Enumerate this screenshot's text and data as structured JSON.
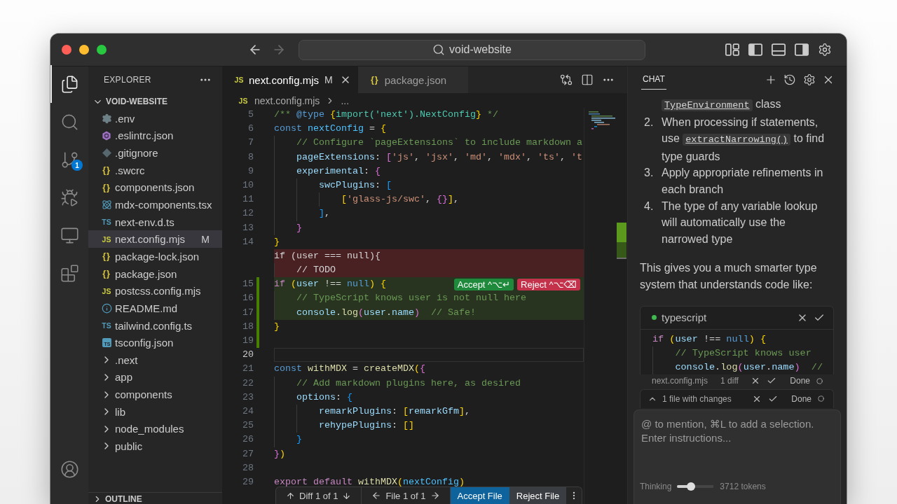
{
  "window": {
    "traffic_lights": [
      {
        "color": "#ff5f57"
      },
      {
        "color": "#febc2e"
      },
      {
        "color": "#28c840"
      }
    ]
  },
  "title_bar": {
    "nav": [
      {
        "kind": "back",
        "disabled": false
      },
      {
        "kind": "forward",
        "disabled": true
      }
    ],
    "command_center": "void-website",
    "layout_toggles": [
      {
        "kind": "primary-sidebar",
        "on": true
      },
      {
        "kind": "panel",
        "on": false
      },
      {
        "kind": "secondary-sidebar",
        "on": true
      }
    ]
  },
  "activity_bar": {
    "items": [
      {
        "kind": "explorer",
        "selected": true
      },
      {
        "kind": "search",
        "selected": false
      },
      {
        "kind": "source-control",
        "selected": false,
        "badge": "1"
      },
      {
        "kind": "run-debug",
        "selected": false
      },
      {
        "kind": "remote",
        "selected": false
      },
      {
        "kind": "extensions",
        "selected": false
      }
    ],
    "bottom": [
      {
        "kind": "accounts"
      }
    ]
  },
  "sidebar": {
    "title": "EXPLORER",
    "folder": {
      "name": "VOID-WEBSITE",
      "expanded": true,
      "children": [
        {
          "name": ".env",
          "kind": "env",
          "selected": false
        },
        {
          "name": ".eslintrc.json",
          "kind": "eslint",
          "selected": false
        },
        {
          "name": ".gitignore",
          "kind": "git",
          "selected": false
        },
        {
          "name": ".swcrc",
          "kind": "json",
          "badge": "{}",
          "selected": false
        },
        {
          "name": "components.json",
          "kind": "json",
          "badge": "{}",
          "selected": false
        },
        {
          "name": "mdx-components.tsx",
          "kind": "react",
          "selected": false
        },
        {
          "name": "next-env.d.ts",
          "kind": "ts",
          "badge": "TS",
          "selected": false
        },
        {
          "name": "next.config.mjs",
          "kind": "js",
          "badge": "JS",
          "status": "M",
          "selected": true
        },
        {
          "name": "package-lock.json",
          "kind": "json",
          "badge": "{}",
          "selected": false
        },
        {
          "name": "package.json",
          "kind": "json",
          "badge": "{}",
          "selected": false
        },
        {
          "name": "postcss.config.mjs",
          "kind": "js",
          "badge": "JS",
          "selected": false
        },
        {
          "name": "README.md",
          "kind": "info",
          "selected": false
        },
        {
          "name": "tailwind.config.ts",
          "kind": "ts",
          "badge": "TS",
          "selected": false
        },
        {
          "name": "tsconfig.json",
          "kind": "tsconfig",
          "badge": "TS",
          "selected": false
        },
        {
          "name": ".next",
          "kind": "folder",
          "expanded": false,
          "selected": false
        },
        {
          "name": "app",
          "kind": "folder",
          "expanded": false,
          "selected": false
        },
        {
          "name": "components",
          "kind": "folder",
          "expanded": false,
          "selected": false
        },
        {
          "name": "lib",
          "kind": "folder",
          "expanded": false,
          "selected": false
        },
        {
          "name": "node_modules",
          "kind": "folder",
          "expanded": false,
          "selected": false
        },
        {
          "name": "public",
          "kind": "folder",
          "expanded": false,
          "selected": false
        }
      ]
    },
    "outline": {
      "title": "OUTLINE",
      "expanded": false
    }
  },
  "editor": {
    "tabs": [
      {
        "name": "next.config.mjs",
        "kind": "js",
        "badge": "JS",
        "status": "M",
        "selected": true
      },
      {
        "name": "package.json",
        "kind": "json",
        "badge": "{}",
        "selected": false
      }
    ],
    "breadcrumb": {
      "kind": "js",
      "badge": "JS",
      "file": "next.config.mjs",
      "more": "..."
    },
    "lines": [
      {
        "number": "5",
        "kind": "normal",
        "current": false,
        "tokens": [
          {
            "text": "/** ",
            "kind": "comment"
          },
          {
            "text": "@type ",
            "kind": "doc-tag"
          },
          {
            "text": "{",
            "kind": "bracket1"
          },
          {
            "text": "import('next').NextConfig",
            "kind": "type"
          },
          {
            "text": "}",
            "kind": "bracket1"
          },
          {
            "text": " */",
            "kind": "comment"
          }
        ]
      },
      {
        "number": "6",
        "kind": "normal",
        "current": false,
        "tokens": [
          {
            "text": "const ",
            "kind": "keyword"
          },
          {
            "text": "nextConfig",
            "kind": "variable"
          },
          {
            "text": " = ",
            "kind": "plain"
          },
          {
            "text": "{",
            "kind": "bracket1"
          }
        ]
      },
      {
        "number": "7",
        "kind": "normal",
        "current": false,
        "tokens": [
          {
            "text": "    // Configure `pageExtensions` to include markdown a",
            "kind": "comment"
          }
        ]
      },
      {
        "number": "8",
        "kind": "normal",
        "current": false,
        "tokens": [
          {
            "text": "    pageExtensions",
            "kind": "property"
          },
          {
            "text": ": ",
            "kind": "plain"
          },
          {
            "text": "[",
            "kind": "bracket2"
          },
          {
            "text": "'js'",
            "kind": "string"
          },
          {
            "text": ", ",
            "kind": "plain"
          },
          {
            "text": "'jsx'",
            "kind": "string"
          },
          {
            "text": ", ",
            "kind": "plain"
          },
          {
            "text": "'md'",
            "kind": "string"
          },
          {
            "text": ", ",
            "kind": "plain"
          },
          {
            "text": "'mdx'",
            "kind": "string"
          },
          {
            "text": ", ",
            "kind": "plain"
          },
          {
            "text": "'ts'",
            "kind": "string"
          },
          {
            "text": ", ",
            "kind": "plain"
          },
          {
            "text": "'t",
            "kind": "string"
          }
        ]
      },
      {
        "number": "9",
        "kind": "normal",
        "current": false,
        "tokens": [
          {
            "text": "    experimental",
            "kind": "property"
          },
          {
            "text": ": ",
            "kind": "plain"
          },
          {
            "text": "{",
            "kind": "bracket2"
          }
        ]
      },
      {
        "number": "10",
        "kind": "normal",
        "current": false,
        "tokens": [
          {
            "text": "        swcPlugins",
            "kind": "property"
          },
          {
            "text": ": ",
            "kind": "plain"
          },
          {
            "text": "[",
            "kind": "bracket3"
          }
        ]
      },
      {
        "number": "11",
        "kind": "normal",
        "current": false,
        "tokens": [
          {
            "text": "            [",
            "kind": "bracket1"
          },
          {
            "text": "'glass-js/swc'",
            "kind": "string"
          },
          {
            "text": ", ",
            "kind": "plain"
          },
          {
            "text": "{}",
            "kind": "bracket2"
          },
          {
            "text": "]",
            "kind": "bracket1"
          },
          {
            "text": ",",
            "kind": "plain"
          }
        ]
      },
      {
        "number": "12",
        "kind": "normal",
        "current": false,
        "tokens": [
          {
            "text": "        ]",
            "kind": "bracket3"
          },
          {
            "text": ",",
            "kind": "plain"
          }
        ]
      },
      {
        "number": "13",
        "kind": "normal",
        "current": false,
        "tokens": [
          {
            "text": "    }",
            "kind": "bracket2"
          }
        ]
      },
      {
        "number": "14",
        "kind": "normal",
        "current": false,
        "tokens": [
          {
            "text": "}",
            "kind": "bracket1"
          }
        ]
      },
      {
        "kind": "deleted",
        "current": false,
        "tokens": [
          {
            "text": "if (user === null){",
            "kind": "plain"
          }
        ]
      },
      {
        "kind": "deleted",
        "current": false,
        "tokens": [
          {
            "text": "    // TODO",
            "kind": "plain"
          }
        ]
      },
      {
        "number": "15",
        "kind": "added",
        "current": false,
        "tokens": [
          {
            "text": "if ",
            "kind": "control"
          },
          {
            "text": "(",
            "kind": "bracket1"
          },
          {
            "text": "user",
            "kind": "property"
          },
          {
            "text": " !== ",
            "kind": "plain"
          },
          {
            "text": "null",
            "kind": "keyword"
          },
          {
            "text": ") {",
            "kind": "bracket1"
          }
        ],
        "actions": [
          {
            "kind": "accept",
            "label": "Accept ^⌥↵"
          },
          {
            "kind": "reject",
            "label": "Reject ^⌥⌫"
          }
        ]
      },
      {
        "number": "16",
        "kind": "added",
        "current": false,
        "tokens": [
          {
            "text": "    // TypeScript knows user is not null here",
            "kind": "comment"
          }
        ]
      },
      {
        "number": "17",
        "kind": "added",
        "current": false,
        "tokens": [
          {
            "text": "    console",
            "kind": "property"
          },
          {
            "text": ".",
            "kind": "plain"
          },
          {
            "text": "log",
            "kind": "function"
          },
          {
            "text": "(",
            "kind": "bracket2"
          },
          {
            "text": "user",
            "kind": "property"
          },
          {
            "text": ".",
            "kind": "plain"
          },
          {
            "text": "name",
            "kind": "property"
          },
          {
            "text": ")",
            "kind": "bracket2"
          },
          {
            "text": "  // Safe!",
            "kind": "comment"
          }
        ]
      },
      {
        "number": "18",
        "kind": "changed",
        "current": false,
        "tokens": [
          {
            "text": "}",
            "kind": "bracket1"
          }
        ]
      },
      {
        "number": "19",
        "kind": "changed",
        "current": false
      },
      {
        "number": "20",
        "kind": "normal",
        "current": true
      },
      {
        "number": "21",
        "kind": "normal",
        "current": false,
        "tokens": [
          {
            "text": "const ",
            "kind": "keyword"
          },
          {
            "text": "withMDX",
            "kind": "function"
          },
          {
            "text": " = ",
            "kind": "plain"
          },
          {
            "text": "createMDX",
            "kind": "function"
          },
          {
            "text": "(",
            "kind": "bracket1"
          },
          {
            "text": "{",
            "kind": "bracket2"
          }
        ]
      },
      {
        "number": "22",
        "kind": "normal",
        "current": false,
        "tokens": [
          {
            "text": "    // Add markdown plugins here, as desired",
            "kind": "comment"
          }
        ]
      },
      {
        "number": "23",
        "kind": "normal",
        "current": false,
        "tokens": [
          {
            "text": "    options",
            "kind": "property"
          },
          {
            "text": ": ",
            "kind": "plain"
          },
          {
            "text": "{",
            "kind": "bracket3"
          }
        ]
      },
      {
        "number": "24",
        "kind": "normal",
        "current": false,
        "tokens": [
          {
            "text": "        remarkPlugins",
            "kind": "property"
          },
          {
            "text": ": ",
            "kind": "plain"
          },
          {
            "text": "[",
            "kind": "bracket1"
          },
          {
            "text": "remarkGfm",
            "kind": "property"
          },
          {
            "text": "]",
            "kind": "bracket1"
          },
          {
            "text": ",",
            "kind": "plain"
          }
        ]
      },
      {
        "number": "25",
        "kind": "normal",
        "current": false,
        "tokens": [
          {
            "text": "        rehypePlugins",
            "kind": "property"
          },
          {
            "text": ": ",
            "kind": "plain"
          },
          {
            "text": "[]",
            "kind": "bracket1"
          }
        ]
      },
      {
        "number": "26",
        "kind": "normal",
        "current": false,
        "tokens": [
          {
            "text": "    }",
            "kind": "bracket3"
          }
        ]
      },
      {
        "number": "27",
        "kind": "normal",
        "current": false,
        "tokens": [
          {
            "text": "}",
            "kind": "bracket2"
          },
          {
            "text": ")",
            "kind": "bracket1"
          }
        ]
      },
      {
        "number": "28",
        "kind": "normal",
        "current": false
      },
      {
        "number": "29",
        "kind": "normal",
        "current": false,
        "tokens": [
          {
            "text": "export default ",
            "kind": "control"
          },
          {
            "text": "withMDX",
            "kind": "function"
          },
          {
            "text": "(",
            "kind": "bracket1"
          },
          {
            "text": "nextConfig",
            "kind": "variable"
          },
          {
            "text": ")",
            "kind": "bracket1"
          }
        ]
      }
    ],
    "diff_toolbar": {
      "diff": "Diff 1 of 1",
      "file": "File 1 of 1",
      "accept": "Accept File",
      "reject": "Reject File"
    }
  },
  "chat": {
    "title": "CHAT",
    "steps": [
      {
        "segments": [
          {
            "kind": "code",
            "text": "TypeEnvironment"
          },
          {
            "kind": "text",
            "text": " class"
          }
        ]
      },
      {
        "marker": "2.",
        "segments": [
          {
            "kind": "text",
            "text": "When processing if statements, use "
          },
          {
            "kind": "code",
            "text": "extractNarrowing()"
          },
          {
            "kind": "text",
            "text": " to find type guards"
          }
        ]
      },
      {
        "marker": "3.",
        "segments": [
          {
            "kind": "text",
            "text": "Apply appropriate refinements in each branch"
          }
        ]
      },
      {
        "marker": "4.",
        "segments": [
          {
            "kind": "text",
            "text": "The type of any variable lookup will automatically use the narrowed type"
          }
        ]
      }
    ],
    "paragraph": "This gives you a much smarter type system that understands code like:",
    "code_block": {
      "language": "typescript",
      "lines": [
        {
          "tokens": [
            {
              "text": "if ",
              "kind": "control"
            },
            {
              "text": "(",
              "kind": "bracket1"
            },
            {
              "text": "user",
              "kind": "property"
            },
            {
              "text": " !== ",
              "kind": "plain"
            },
            {
              "text": "null",
              "kind": "keyword"
            },
            {
              "text": ") {",
              "kind": "bracket1"
            }
          ]
        },
        {
          "tokens": [
            {
              "text": "    // TypeScript knows user",
              "kind": "comment"
            }
          ]
        },
        {
          "tokens": [
            {
              "text": "    console",
              "kind": "property"
            },
            {
              "text": ".",
              "kind": "plain"
            },
            {
              "text": "log",
              "kind": "function"
            },
            {
              "text": "(",
              "kind": "bracket2"
            },
            {
              "text": "user",
              "kind": "property"
            },
            {
              "text": ".",
              "kind": "plain"
            },
            {
              "text": "name",
              "kind": "property"
            },
            {
              "text": ")",
              "kind": "bracket2"
            },
            {
              "text": "  //",
              "kind": "comment"
            }
          ]
        }
      ]
    },
    "pending_file": {
      "name": "next.config.mjs",
      "diffs": "1 diff",
      "status": "Done"
    },
    "changes": {
      "label": "1 file with changes",
      "status": "Done"
    },
    "input": {
      "placeholder": "@ to mention, ⌘L to add a selection. Enter instructions...",
      "thinking": {
        "label": "Thinking",
        "level": 0.38,
        "reading": "3712 tokens"
      }
    }
  }
}
